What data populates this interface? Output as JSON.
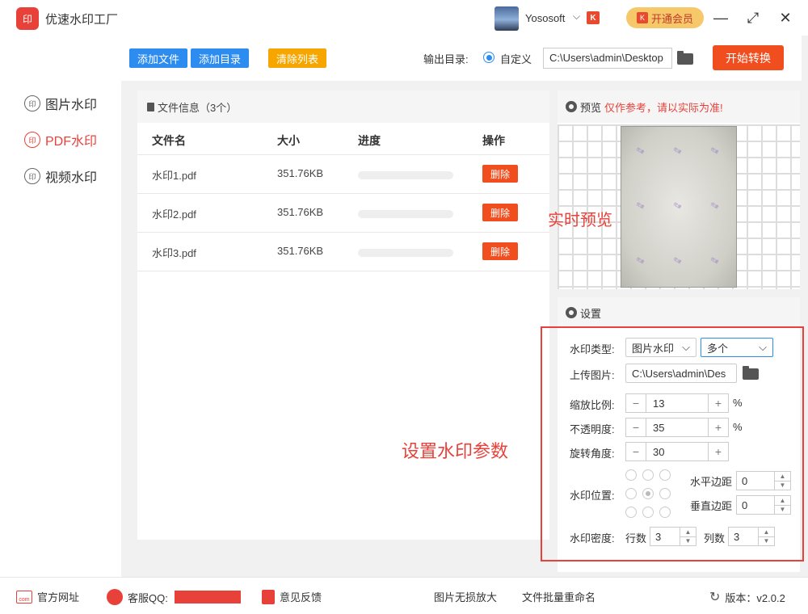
{
  "app": {
    "title": "优速水印工厂",
    "logo_text": "印"
  },
  "user": {
    "name": "Yososoft",
    "badge": "K",
    "vip_label": "开通会员"
  },
  "window": {
    "min": "—",
    "max": "⤢",
    "close": "✕"
  },
  "sidebar": {
    "items": [
      {
        "label": "图片水印",
        "icon": "印",
        "active": false
      },
      {
        "label": "PDF水印",
        "icon": "印",
        "active": true
      },
      {
        "label": "视频水印",
        "icon": "印",
        "active": false
      }
    ]
  },
  "toolbar": {
    "add_file": "添加文件",
    "add_dir": "添加目录",
    "clear_list": "清除列表",
    "output_label": "输出目录:",
    "radio_label": "自定义",
    "output_path": "C:\\Users\\admin\\Desktop",
    "start": "开始转换"
  },
  "files": {
    "header": "文件信息（3个）",
    "columns": [
      "文件名",
      "大小",
      "进度",
      "操作"
    ],
    "rows": [
      {
        "name": "水印1.pdf",
        "size": "351.76KB",
        "progress": 0,
        "action": "删除"
      },
      {
        "name": "水印2.pdf",
        "size": "351.76KB",
        "progress": 0,
        "action": "删除"
      },
      {
        "name": "水印3.pdf",
        "size": "351.76KB",
        "progress": 0,
        "action": "删除"
      }
    ]
  },
  "preview": {
    "label": "预览",
    "warning": "仅作参考，请以实际为准!",
    "annotation": "实时预览",
    "watermark_text": "优速"
  },
  "settings": {
    "label": "设置",
    "annotation": "设置水印参数",
    "type_label": "水印类型:",
    "type_value": "图片水印",
    "mode_value": "多个",
    "upload_label": "上传图片:",
    "upload_path": "C:\\Users\\admin\\Des",
    "scale_label": "缩放比例:",
    "scale_value": "13",
    "opacity_label": "不透明度:",
    "opacity_value": "35",
    "rotate_label": "旋转角度:",
    "rotate_value": "30",
    "percent": "%",
    "minus": "−",
    "plus": "+",
    "position_label": "水印位置:",
    "h_margin_label": "水平边距",
    "h_margin_value": "0",
    "v_margin_label": "垂直边距",
    "v_margin_value": "0",
    "density_label": "水印密度:",
    "rows_label": "行数",
    "rows_value": "3",
    "cols_label": "列数",
    "cols_value": "3"
  },
  "footer": {
    "website": "官方网址",
    "qq": "客服QQ:",
    "feedback": "意见反馈",
    "enlarge": "图片无损放大",
    "rename": "文件批量重命名",
    "version": "版本：v2.0.2"
  }
}
